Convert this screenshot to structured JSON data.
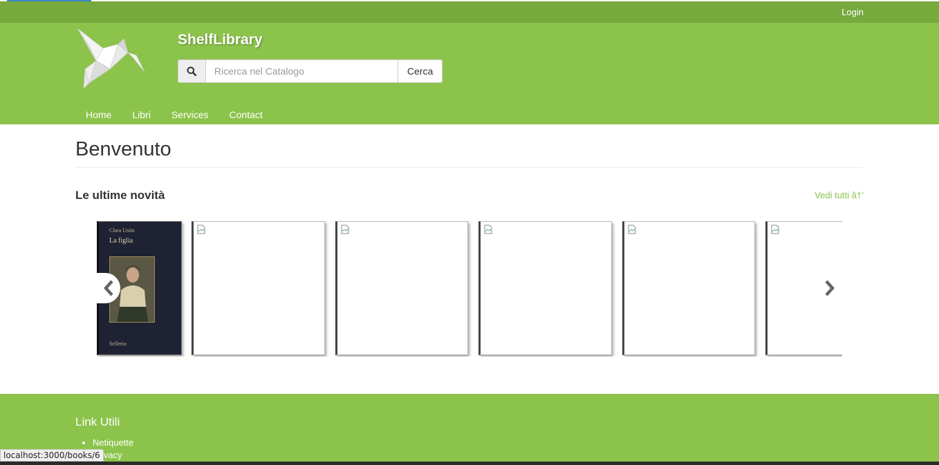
{
  "topbar": {
    "login_label": "Login"
  },
  "header": {
    "brand": "ShelfLibrary",
    "search": {
      "placeholder": "Ricerca nel Catalogo",
      "value": "",
      "button_label": "Cerca"
    }
  },
  "nav": {
    "items": [
      "Home",
      "Libri",
      "Services",
      "Contact"
    ]
  },
  "main": {
    "title": "Benvenuto",
    "section_title": "Le ultime novità",
    "see_all_label": "Vedi tutti  â†’"
  },
  "carousel": {
    "first_book": {
      "author": "Clara Usón",
      "title": "La figlia",
      "publisher": "Sellerio"
    }
  },
  "footer": {
    "title": "Link Utili",
    "links": [
      "Netiquette",
      "Privacy"
    ]
  },
  "status_bar": {
    "url": "localhost:3000/books/6"
  },
  "colors": {
    "brand_green": "#8cc34b",
    "topbar_green": "#77a93d",
    "link_green": "#8cc34b"
  }
}
